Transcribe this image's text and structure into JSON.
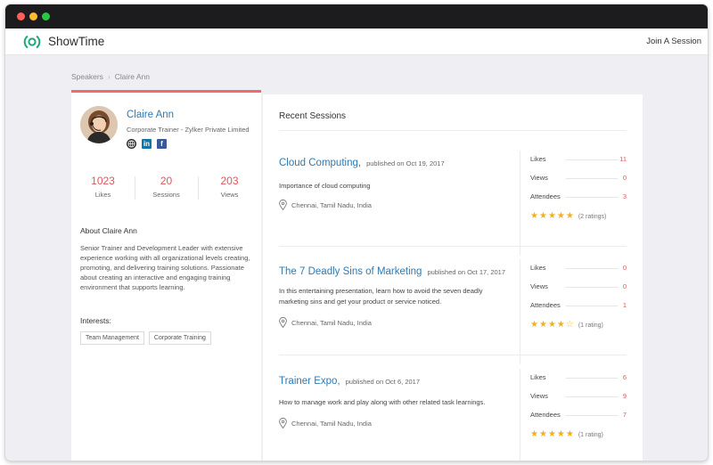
{
  "app": {
    "name": "ShowTime",
    "join_label": "Join A Session"
  },
  "breadcrumb": {
    "parent": "Speakers",
    "separator": "›",
    "current": "Claire Ann"
  },
  "profile": {
    "name": "Claire Ann",
    "title": "Corporate Trainer - Zylker Private Limited",
    "social": [
      "web-icon",
      "linkedin-icon",
      "facebook-icon"
    ],
    "stats": [
      {
        "value": "1023",
        "label": "Likes"
      },
      {
        "value": "20",
        "label": "Sessions"
      },
      {
        "value": "203",
        "label": "Views"
      }
    ],
    "about_heading": "About Claire Ann",
    "about_text": "Senior Trainer and Development Leader with extensive experience working with all organizational levels creating, promoting, and delivering training solutions. Passionate about creating an interactive and engaging training environment that supports learning.",
    "interests_heading": "Interests:",
    "interests": [
      "Team Management",
      "Corporate Training"
    ]
  },
  "sessions": {
    "heading": "Recent Sessions",
    "items": [
      {
        "title": "Cloud Computing,",
        "published": "published on Oct 19, 2017",
        "description": "Importance of cloud computing",
        "location": "Chennai, Tamil Nadu, India",
        "likes_label": "Likes",
        "likes": "11",
        "views_label": "Views",
        "views": "0",
        "attendees_label": "Attendees",
        "attendees": "3",
        "stars": 5,
        "ratings_text": "(2 ratings)"
      },
      {
        "title": "The 7 Deadly Sins of Marketing",
        "published": "published on Oct 17, 2017",
        "description": "In this entertaining presentation, learn how to avoid the seven deadly marketing sins and get your product or service noticed.",
        "location": "Chennai, Tamil Nadu, India",
        "likes_label": "Likes",
        "likes": "0",
        "views_label": "Views",
        "views": "0",
        "attendees_label": "Attendees",
        "attendees": "1",
        "stars": 4,
        "ratings_text": "(1 rating)"
      },
      {
        "title": "Trainer Expo,",
        "published": "published on Oct 6, 2017",
        "description": "How to manage work and play along with other related task learnings.",
        "location": "Chennai, Tamil Nadu, India",
        "likes_label": "Likes",
        "likes": "6",
        "views_label": "Views",
        "views": "9",
        "attendees_label": "Attendees",
        "attendees": "7",
        "stars": 5,
        "ratings_text": "(1 rating)"
      }
    ]
  },
  "colors": {
    "accent_blue": "#2d7ab5",
    "accent_red": "#e0565b",
    "profile_top_border": "#ee6b6b",
    "star": "#f2b01e",
    "logo_green": "#1fa67a"
  }
}
